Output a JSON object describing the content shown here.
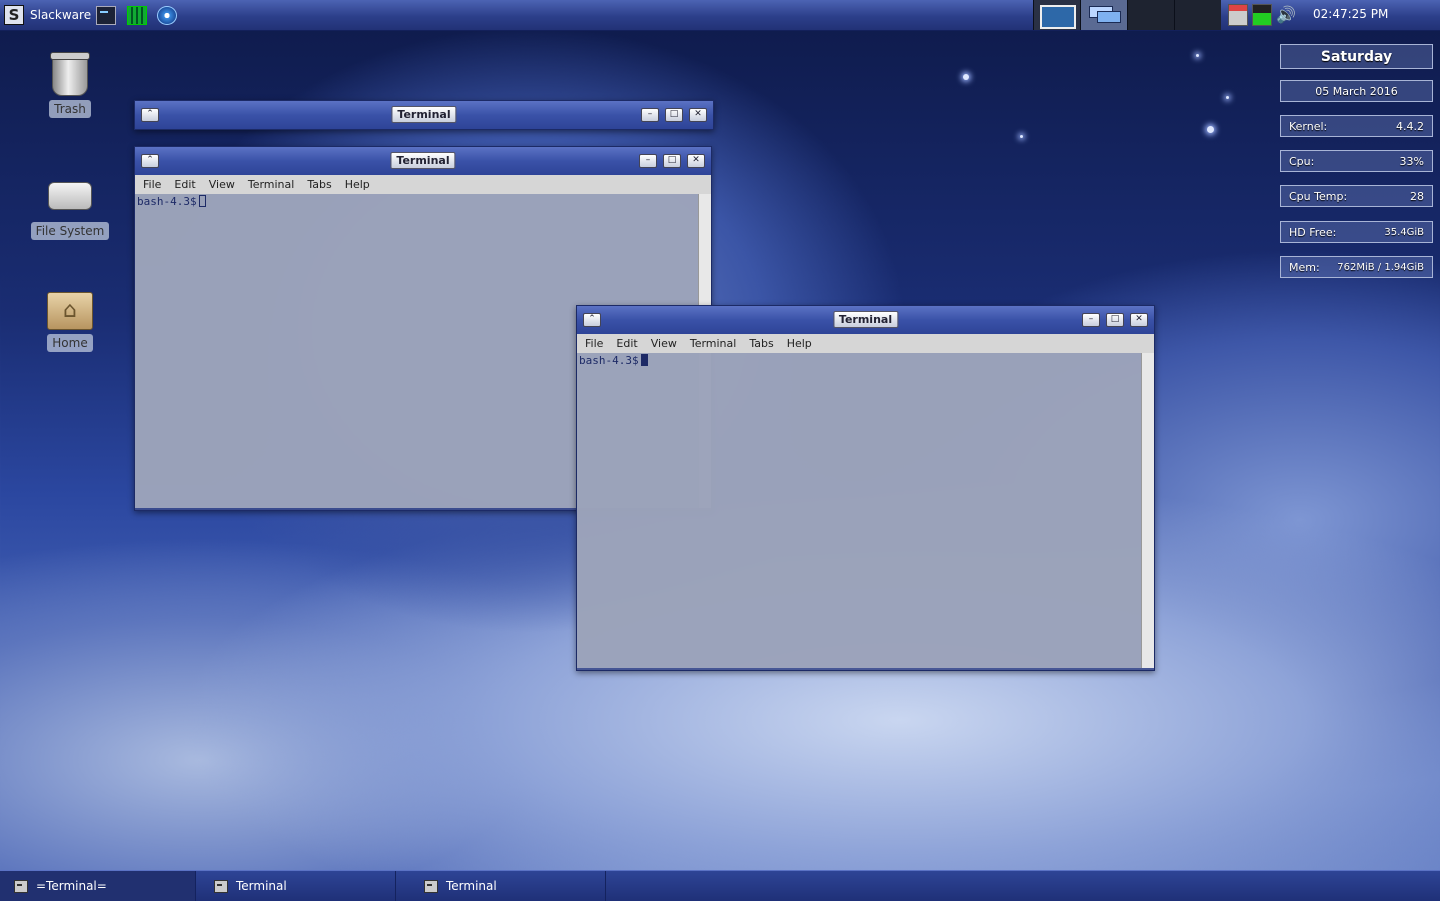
{
  "top_panel": {
    "menu_label": "Slackware",
    "menu_logo": "S",
    "launchers": [
      "terminal-launcher-icon",
      "system-monitor-icon",
      "web-browser-icon"
    ],
    "clock": "02:47:25 PM",
    "volume_glyph": "🔊"
  },
  "desktop": {
    "icons": [
      {
        "label": "Trash",
        "icon": "trash-icon"
      },
      {
        "label": "File System",
        "icon": "drive-icon"
      },
      {
        "label": "Home",
        "icon": "home-folder-icon",
        "glyph": "⌂"
      }
    ]
  },
  "conky": {
    "day": "Saturday",
    "date": "05  March  2016",
    "kernel_label": "Kernel:",
    "kernel_value": "4.4.2",
    "cpu_label": "Cpu:",
    "cpu_value": "33%",
    "cpu_temp_label": "Cpu  Temp:",
    "cpu_temp_value": "28",
    "hd_label": "HD  Free:",
    "hd_value": "35.4GiB",
    "mem_label": "Mem:",
    "mem_value": "762MiB  /  1.94GiB"
  },
  "windows": [
    {
      "title": "Terminal",
      "shaded": true
    },
    {
      "title": "Terminal",
      "menu": [
        "File",
        "Edit",
        "View",
        "Terminal",
        "Tabs",
        "Help"
      ],
      "prompt": "bash-4.3$"
    },
    {
      "title": "Terminal",
      "menu": [
        "File",
        "Edit",
        "View",
        "Terminal",
        "Tabs",
        "Help"
      ],
      "prompt": "bash-4.3$"
    }
  ],
  "window_buttons": {
    "shade": "⌃",
    "minimize": "–",
    "maximize": "□",
    "close": "✕"
  },
  "taskbar": {
    "tasks": [
      {
        "label": "=Terminal=",
        "active": true
      },
      {
        "label": "Terminal",
        "active": false
      },
      {
        "label": "Terminal",
        "active": false
      }
    ]
  },
  "colors": {
    "panel": "#2c3f8a",
    "accent": "#4c63b3",
    "cursor_active": "#1d2a66"
  }
}
